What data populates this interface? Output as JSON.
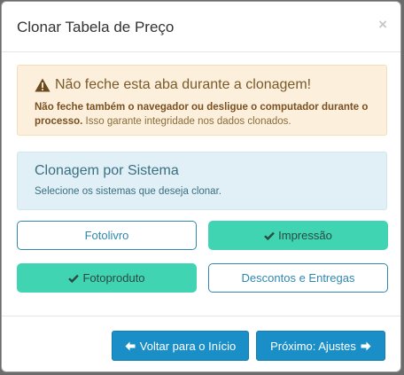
{
  "dialog": {
    "title": "Clonar Tabela de Preço",
    "close_label": "×"
  },
  "warning": {
    "heading": "Não feche esta aba durante a clonagem!",
    "bold_text": "Não feche também o navegador ou desligue o computador durante o processo.",
    "text": "Isso garante integridade nos dados clonados."
  },
  "info": {
    "heading": "Clonagem por Sistema",
    "text": "Selecione os sistemas que deseja clonar."
  },
  "systems": [
    {
      "label": "Fotolivro",
      "selected": false
    },
    {
      "label": "Impressão",
      "selected": true
    },
    {
      "label": "Fotoproduto",
      "selected": true
    },
    {
      "label": "Descontos e Entregas",
      "selected": false
    }
  ],
  "footer": {
    "back_label": "Voltar para o Início",
    "next_label": "Próximo: Ajustes"
  },
  "colors": {
    "primary": "#1a8fc7",
    "selected": "#40d4b2",
    "warning_bg": "#fcf0dc",
    "info_bg": "#e0f0f6"
  }
}
